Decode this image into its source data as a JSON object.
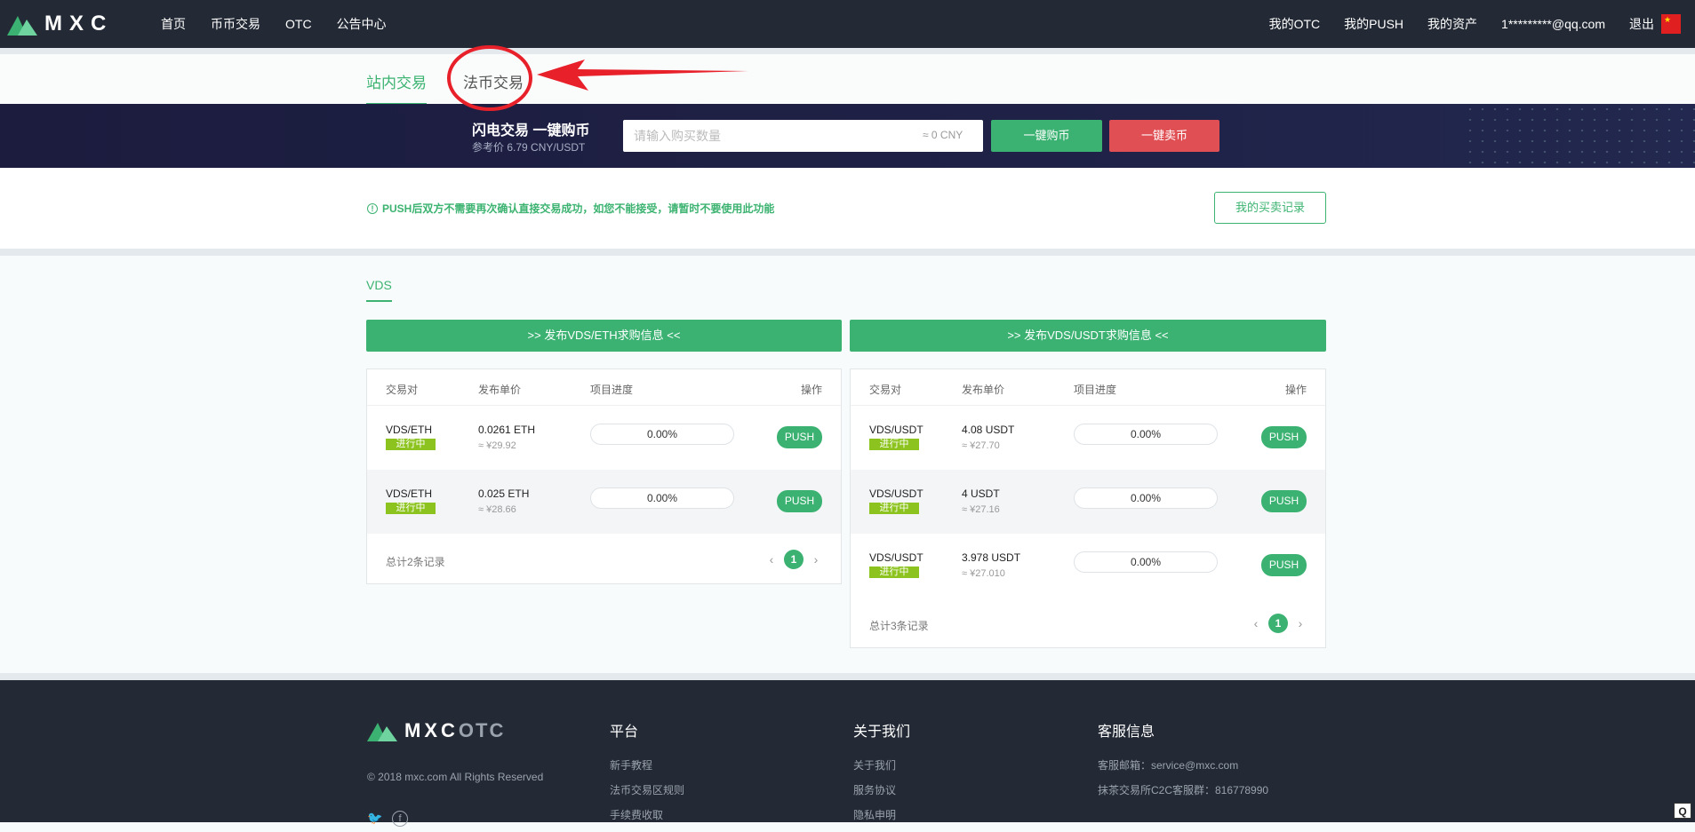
{
  "nav": {
    "brand": "MXC",
    "left_links": [
      "首页",
      "币币交易",
      "OTC",
      "公告中心"
    ],
    "right_links": [
      "我的OTC",
      "我的PUSH",
      "我的资产",
      "1*********@qq.com",
      "退出"
    ],
    "flag_icon": "cn-flag-icon"
  },
  "tabs": {
    "active": "站内交易",
    "inactive": "法币交易"
  },
  "flash": {
    "title": "闪电交易 一键购币",
    "subtitle": "参考价 6.79 CNY/USDT",
    "input_placeholder": "请输入购买数量",
    "cny": "≈ 0 CNY",
    "buy_label": "一键购币",
    "sell_label": "一键卖币"
  },
  "notice": {
    "text": "PUSH后双方不需要再次确认直接交易成功，如您不能接受，请暂时不要使用此功能",
    "records_button": "我的买卖记录"
  },
  "section_tab": "VDS",
  "columns": {
    "pair": "交易对",
    "price": "发布单价",
    "progress": "项目进度",
    "action": "操作"
  },
  "status_label": "进行中",
  "push_label": "PUSH",
  "left_panel": {
    "publish_label": ">>  发布VDS/ETH求购信息  <<",
    "rows": [
      {
        "pair": "VDS/ETH",
        "price": "0.0261 ETH",
        "cny": "≈ ¥29.92",
        "progress": "0.00%"
      },
      {
        "pair": "VDS/ETH",
        "price": "0.025 ETH",
        "cny": "≈ ¥28.66",
        "progress": "0.00%"
      }
    ],
    "total": "总计2条记录",
    "page": "1"
  },
  "right_panel": {
    "publish_label": ">>  发布VDS/USDT求购信息  <<",
    "rows": [
      {
        "pair": "VDS/USDT",
        "price": "4.08 USDT",
        "cny": "≈ ¥27.70",
        "progress": "0.00%"
      },
      {
        "pair": "VDS/USDT",
        "price": "4 USDT",
        "cny": "≈ ¥27.16",
        "progress": "0.00%"
      },
      {
        "pair": "VDS/USDT",
        "price": "3.978 USDT",
        "cny": "≈ ¥27.010",
        "progress": "0.00%"
      }
    ],
    "total": "总计3条记录",
    "page": "1"
  },
  "footer": {
    "brand_main": "MXC",
    "brand_sub": "OTC",
    "copyright": "© 2018 mxc.com All Rights Reserved",
    "platform": {
      "title": "平台",
      "items": [
        "新手教程",
        "法币交易区规则",
        "手续费收取"
      ]
    },
    "about": {
      "title": "关于我们",
      "items": [
        "关于我们",
        "服务协议",
        "隐私申明"
      ]
    },
    "service": {
      "title": "客服信息",
      "items": [
        "客服邮箱：service@mxc.com",
        "抹茶交易所C2C客服群：816778990"
      ]
    }
  },
  "colors": {
    "accent": "#3bb272",
    "danger": "#e04f54",
    "nav_bg": "#232a35",
    "annotation": "#e8202a"
  }
}
